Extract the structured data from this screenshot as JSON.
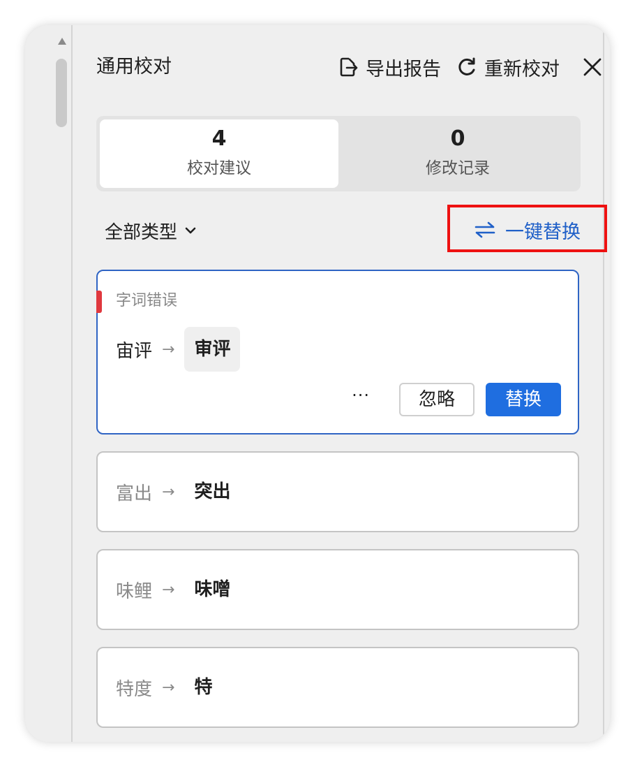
{
  "header": {
    "title": "通用校对",
    "export_label": "导出报告",
    "recheck_label": "重新校对",
    "export_icon": "export-icon",
    "recheck_icon": "refresh-icon",
    "close_icon": "close-icon"
  },
  "tabs": [
    {
      "count": "4",
      "label": "校对建议",
      "active": true
    },
    {
      "count": "0",
      "label": "修改记录",
      "active": false
    }
  ],
  "filter": {
    "label": "全部类型",
    "icon": "chevron-down-icon"
  },
  "replace_all": {
    "label": "一键替换",
    "icon": "swap-arrows-icon",
    "highlight_color": "#ee1111"
  },
  "suggestions": [
    {
      "type": "字词错误",
      "original": "宙评",
      "suggestion": "审评",
      "expanded": true
    },
    {
      "original": "富出",
      "suggestion": "突出"
    },
    {
      "original": "味鲤",
      "suggestion": "味噌"
    },
    {
      "original": "特度",
      "suggestion": "特"
    }
  ],
  "card_actions": {
    "more_label": "···",
    "ignore_label": "忽略",
    "replace_label": "替换"
  },
  "arrow_glyph": "→",
  "colors": {
    "accent": "#1f6ee0",
    "link": "#2060c8",
    "error_marker": "#e0383e",
    "active_card_border": "#2f64c4"
  }
}
